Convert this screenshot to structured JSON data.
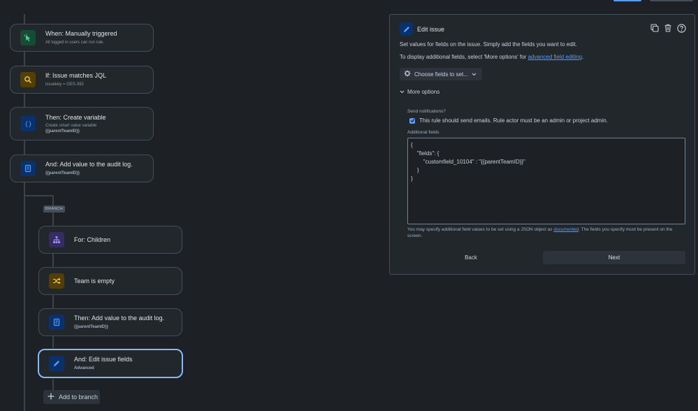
{
  "flow": {
    "trigger": {
      "title": "When: Manually triggered",
      "subtitle": "All logged in users can run rule."
    },
    "condition": {
      "title": "If: Issue matches JQL",
      "subtitle": "issuekey = GES-392"
    },
    "create_variable": {
      "title": "Then: Create variable",
      "subtitle": "Create smart value variable",
      "value": "{{parentTeamID}}"
    },
    "audit_log_1": {
      "title": "And: Add value to the audit log.",
      "value": "{{parentTeamID}}"
    },
    "branch_tag": "BRANCH",
    "for_children": {
      "title": "For: Children"
    },
    "team_empty": {
      "title": "Team is empty"
    },
    "audit_log_2": {
      "title": "Then: Add value to the audit log.",
      "value": "{{parentTeamID}}"
    },
    "edit_fields": {
      "title": "And: Edit issue fields",
      "subtitle": "Advanced"
    },
    "add_branch_label": "Add to branch"
  },
  "panel": {
    "title": "Edit issue",
    "description": "Set values for fields on the issue. Simply add the fields you want to edit.",
    "additional_prefix": "To display additional fields, select 'More options' for ",
    "additional_link": "advanced field editing",
    "additional_suffix": ".",
    "choose_fields_label": "Choose fields to set...",
    "more_options_label": "More options",
    "send_notifications_label": "Send notifications?",
    "send_notifications_checkbox": "This rule should send emails. Rule actor must be an admin or project admin.",
    "send_notifications_checked": true,
    "additional_fields_label": "Additional fields",
    "additional_fields_value": "{\n    \"fields\": {\n        \"customfield_10104\" : \"{{parentTeamID}}\"\n    }\n}",
    "help_prefix": "You may specify additional field values to be set using a JSON object as ",
    "help_link": "documented",
    "help_suffix": ". The fields you specify must be present on the screen.",
    "back_label": "Back",
    "next_label": "Next"
  },
  "colors": {
    "background": "#1d2125",
    "card": "#22272b",
    "accent": "#579dff",
    "selected_border": "#85b8ff"
  },
  "icons": {
    "trigger": "cursor-click-icon",
    "condition": "search-icon",
    "variable": "braces-icon",
    "audit": "document-icon",
    "children": "hierarchy-icon",
    "team_empty": "shuffle-icon",
    "edit": "pencil-icon",
    "add": "plus-icon"
  }
}
